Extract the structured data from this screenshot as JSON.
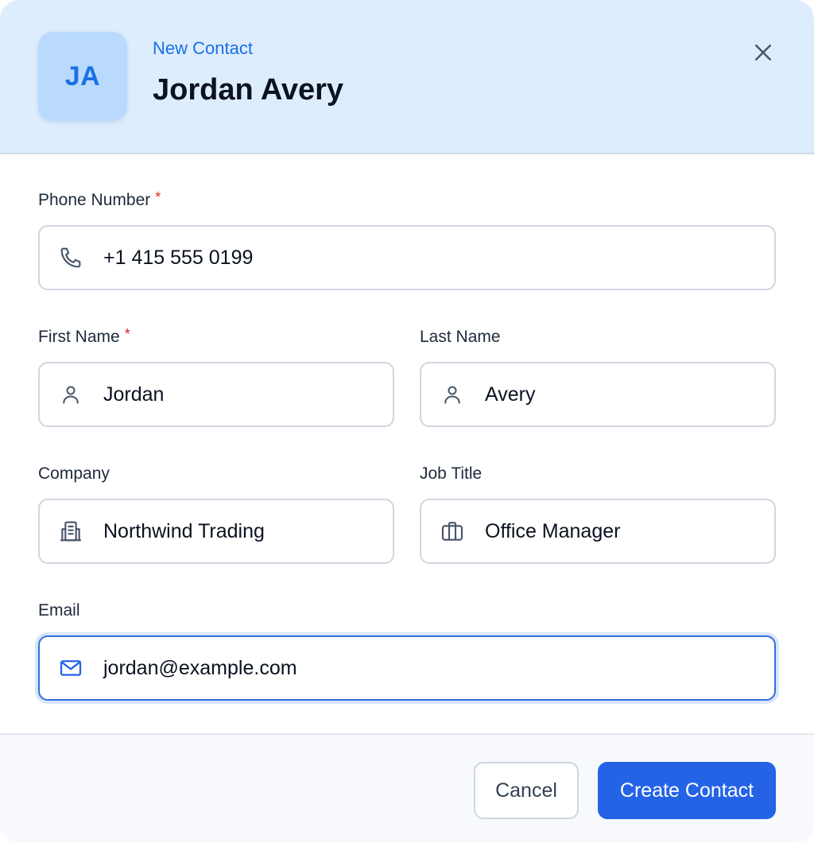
{
  "header": {
    "avatar_initials": "JA",
    "eyebrow": "New Contact",
    "title": "Jordan Avery",
    "close_icon": "close-icon"
  },
  "form": {
    "phone": {
      "label": "Phone Number",
      "required": "*",
      "value": "+1 415 555 0199",
      "icon": "phone-icon"
    },
    "first_name": {
      "label": "First Name",
      "required": "*",
      "value": "Jordan",
      "icon": "user-icon"
    },
    "last_name": {
      "label": "Last Name",
      "value": "Avery",
      "icon": "user-icon"
    },
    "company": {
      "label": "Company",
      "value": "Northwind Trading",
      "icon": "building-icon"
    },
    "job_title": {
      "label": "Job Title",
      "value": "Office Manager",
      "icon": "briefcase-icon"
    },
    "email": {
      "label": "Email",
      "value": "jordan@example.com",
      "icon": "mail-icon",
      "focused": true
    }
  },
  "footer": {
    "cancel_label": "Cancel",
    "create_label": "Create Contact"
  },
  "colors": {
    "accent": "#2463e6",
    "header_bg": "#deedfd",
    "avatar_bg": "#b9dafd",
    "required": "#e02424"
  }
}
